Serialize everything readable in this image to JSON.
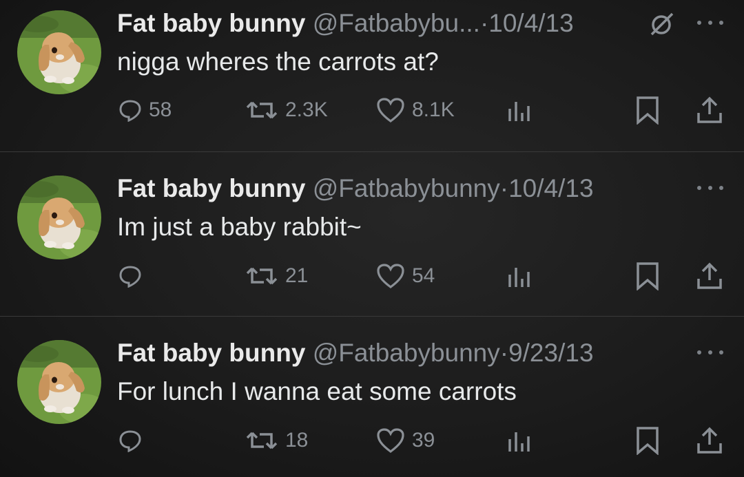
{
  "colors": {
    "background": "#1a1a1a",
    "text": "#e7e9ea",
    "muted": "#8b9096",
    "divider": "#3a3a3a"
  },
  "icons": [
    "bunny-avatar",
    "mute-icon",
    "more-icon",
    "reply-icon",
    "retweet-icon",
    "like-icon",
    "views-icon",
    "bookmark-icon",
    "share-icon"
  ],
  "tweets": [
    {
      "name": "Fat baby bunny",
      "handle": "@Fatbabybu...",
      "sep": "·",
      "date": "10/4/13",
      "text": "nigga wheres the carrots at?",
      "replies": "58",
      "retweets": "2.3K",
      "likes": "8.1K"
    },
    {
      "name": "Fat baby bunny",
      "handle": "@Fatbabybunny",
      "sep": "·",
      "date": "10/4/13",
      "text": "Im just a baby rabbit~",
      "replies": "",
      "retweets": "21",
      "likes": "54"
    },
    {
      "name": "Fat baby bunny",
      "handle": "@Fatbabybunny",
      "sep": "·",
      "date": "9/23/13",
      "text": "For lunch I wanna eat some carrots",
      "replies": "",
      "retweets": "18",
      "likes": "39"
    }
  ]
}
